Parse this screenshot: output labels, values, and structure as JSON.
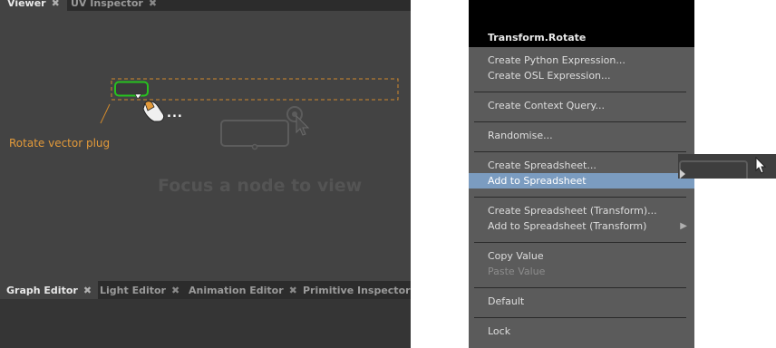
{
  "viewer_tabs": [
    {
      "label": "Viewer",
      "close": "✖",
      "active": true
    },
    {
      "label": "UV Inspector",
      "close": "✖",
      "active": false
    }
  ],
  "viewer": {
    "placeholder": "Focus a node to view",
    "annotation": "Rotate vector plug",
    "drag_hint": "..."
  },
  "bottom_tabs": [
    {
      "label": "Graph Editor",
      "close": "✖",
      "active": true
    },
    {
      "label": "Light Editor",
      "close": "✖",
      "active": false
    },
    {
      "label": "Animation Editor",
      "close": "✖",
      "active": false
    },
    {
      "label": "Primitive Inspector",
      "close": "✖",
      "active": false
    }
  ],
  "context_menu": {
    "title": "Transform.Rotate",
    "items": [
      {
        "label": "Create Python Expression...",
        "enabled": true
      },
      {
        "label": "Create OSL Expression...",
        "enabled": true
      },
      {
        "label": "Create Context Query...",
        "enabled": true
      },
      {
        "label": "Randomise...",
        "enabled": true
      },
      {
        "label": "Create Spreadsheet...",
        "enabled": true
      },
      {
        "label": "Add to Spreadsheet",
        "enabled": true,
        "highlighted": true,
        "submenu": true
      },
      {
        "label": "Create Spreadsheet (Transform)...",
        "enabled": true
      },
      {
        "label": "Add to Spreadsheet (Transform)",
        "enabled": true,
        "submenu": true
      },
      {
        "label": "Copy Value",
        "enabled": true
      },
      {
        "label": "Paste Value",
        "enabled": false
      },
      {
        "label": "Default",
        "enabled": true
      },
      {
        "label": "Lock",
        "enabled": true
      }
    ]
  },
  "colors": {
    "highlight": "#7b9cc0",
    "annotation": "#e39a3a",
    "plug_outline": "#27c21f"
  }
}
